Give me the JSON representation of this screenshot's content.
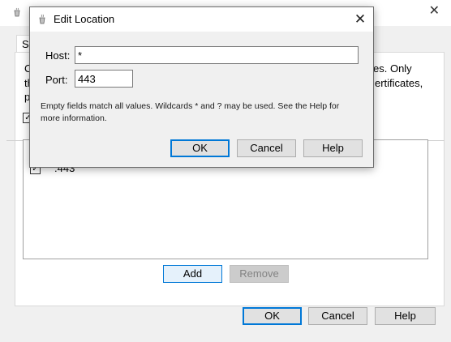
{
  "background": {
    "tab_label": "SS",
    "desc_fragments": [
      "C",
      "es. Only",
      "th",
      "ertificates,",
      "p"
    ],
    "row_value": ".443",
    "add_label": "Add",
    "remove_label": "Remove",
    "ok_label": "OK",
    "cancel_label": "Cancel",
    "help_label": "Help"
  },
  "dialog": {
    "title": "Edit Location",
    "host_label": "Host:",
    "host_value": "*",
    "port_label": "Port:",
    "port_value": "443",
    "info_text": "Empty fields match all values. Wildcards * and ? may be used. See the Help for more information.",
    "ok_label": "OK",
    "cancel_label": "Cancel",
    "help_label": "Help"
  },
  "colors": {
    "accent": "#0078d7",
    "window_bg": "#f0f0f0",
    "button_bg": "#e1e1e1",
    "focus_button_bg": "#e5f1fb",
    "disabled_button_bg": "#cccccc"
  }
}
